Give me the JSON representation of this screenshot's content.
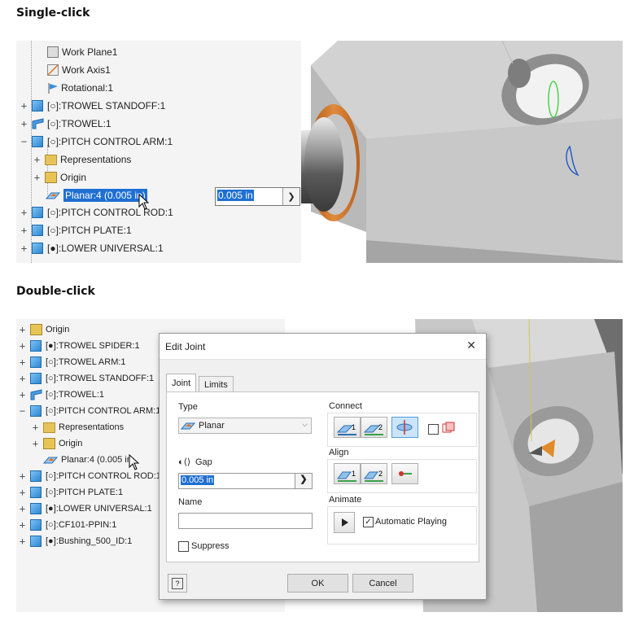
{
  "sections": {
    "single_title": "Single-click",
    "double_title": "Double-click"
  },
  "top_tree": [
    {
      "label": "Work Plane1",
      "icon": "work-plane-icon"
    },
    {
      "label": "Work Axis1",
      "icon": "work-axis-icon"
    },
    {
      "label": "Rotational:1",
      "icon": "rotational-joint-icon"
    },
    {
      "label": "[○]:TROWEL STANDOFF:1",
      "icon": "part-icon",
      "expander": "+"
    },
    {
      "label": "[○]:TROWEL:1",
      "icon": "part-icon",
      "expander": "+"
    },
    {
      "label": "[○]:PITCH CONTROL ARM:1",
      "icon": "part-icon",
      "expander": "−"
    },
    {
      "label": "Representations",
      "icon": "folder-icon",
      "expander": "+"
    },
    {
      "label": "Origin",
      "icon": "origin-icon",
      "expander": "+"
    },
    {
      "label": "Planar:4 (0.005 in)",
      "icon": "planar-joint-icon"
    },
    {
      "label": "[○]:PITCH CONTROL ROD:1",
      "icon": "part-icon",
      "expander": "+"
    },
    {
      "label": "[○]:PITCH PLATE:1",
      "icon": "part-icon",
      "expander": "+"
    },
    {
      "label": "[●]:LOWER UNIVERSAL:1",
      "icon": "part-icon",
      "expander": "+"
    }
  ],
  "top_edit": {
    "value": "0.005 in"
  },
  "bottom_tree": [
    {
      "label": "Origin",
      "icon": "origin-icon",
      "expander": "+"
    },
    {
      "label": "[●]:TROWEL SPIDER:1",
      "icon": "part-icon",
      "expander": "+"
    },
    {
      "label": "[○]:TROWEL ARM:1",
      "icon": "part-icon",
      "expander": "+"
    },
    {
      "label": "[○]:TROWEL STANDOFF:1",
      "icon": "part-icon",
      "expander": "+"
    },
    {
      "label": "[○]:TROWEL:1",
      "icon": "part-icon",
      "expander": "+"
    },
    {
      "label": "[○]:PITCH CONTROL ARM:1",
      "icon": "part-icon",
      "expander": "−"
    },
    {
      "label": "Representations",
      "icon": "folder-icon",
      "expander": "+"
    },
    {
      "label": "Origin",
      "icon": "origin-icon",
      "expander": "+"
    },
    {
      "label": "Planar:4 (0.005 in",
      "icon": "planar-joint-icon"
    },
    {
      "label": "[○]:PITCH CONTROL ROD:1",
      "icon": "part-icon",
      "expander": "+"
    },
    {
      "label": "[○]:PITCH PLATE:1",
      "icon": "part-icon",
      "expander": "+"
    },
    {
      "label": "[●]:LOWER UNIVERSAL:1",
      "icon": "part-icon",
      "expander": "+"
    },
    {
      "label": "[○]:CF101-PPIN:1",
      "icon": "part-icon",
      "expander": "+"
    },
    {
      "label": "[●]:Bushing_500_ID:1",
      "icon": "part-icon",
      "expander": "+"
    }
  ],
  "dialog": {
    "title": "Edit Joint",
    "close": "✕",
    "tabs": [
      "Joint",
      "Limits"
    ],
    "type_label": "Type",
    "type_value": "Planar",
    "gap_label": "Gap",
    "gap_value": "0.005 in",
    "name_label": "Name",
    "name_value": "",
    "suppress_label": "Suppress",
    "connect_label": "Connect",
    "connect_btn1": "1",
    "connect_btn2": "2",
    "align_label": "Align",
    "align_btn1": "1",
    "align_btn2": "2",
    "animate_label": "Animate",
    "auto_play_label": "Automatic Playing",
    "auto_play_checked": true,
    "ok_label": "OK",
    "cancel_label": "Cancel",
    "help_icon": "?"
  },
  "colors": {
    "selection": "#1f6fd2",
    "part_blue": "#2d86d0",
    "bushing_orange": "#d4772a",
    "dialog_bg": "#f0f0f0"
  }
}
